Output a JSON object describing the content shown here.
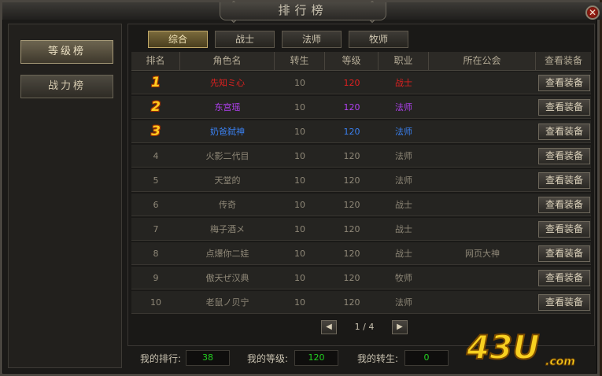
{
  "window": {
    "title": "排行榜",
    "close_icon": "close-icon"
  },
  "sidebar": {
    "items": [
      {
        "label": "等级榜",
        "active": true
      },
      {
        "label": "战力榜",
        "active": false
      }
    ]
  },
  "tabs": [
    {
      "label": "综合",
      "active": true
    },
    {
      "label": "战士",
      "active": false
    },
    {
      "label": "法师",
      "active": false
    },
    {
      "label": "牧师",
      "active": false
    }
  ],
  "table": {
    "headers": [
      "排名",
      "角色名",
      "转生",
      "等级",
      "职业",
      "所在公会",
      "查看装备"
    ],
    "rows": [
      {
        "rank": "1",
        "name": "先知ミ心",
        "rebirth": "10",
        "level": "120",
        "class": "战士",
        "guild": "",
        "button": "查看装备",
        "color": "#e02020"
      },
      {
        "rank": "2",
        "name": "东宫瑶",
        "rebirth": "10",
        "level": "120",
        "class": "法师",
        "guild": "",
        "button": "查看装备",
        "color": "#b040f0"
      },
      {
        "rank": "3",
        "name": "奶爸弑神",
        "rebirth": "10",
        "level": "120",
        "class": "法师",
        "guild": "",
        "button": "查看装备",
        "color": "#3a80f0"
      },
      {
        "rank": "4",
        "name": "火影二代目",
        "rebirth": "10",
        "level": "120",
        "class": "法师",
        "guild": "",
        "button": "查看装备",
        "color": ""
      },
      {
        "rank": "5",
        "name": "天堂的",
        "rebirth": "10",
        "level": "120",
        "class": "法师",
        "guild": "",
        "button": "查看装备",
        "color": ""
      },
      {
        "rank": "6",
        "name": "传奇",
        "rebirth": "10",
        "level": "120",
        "class": "战士",
        "guild": "",
        "button": "查看装备",
        "color": ""
      },
      {
        "rank": "7",
        "name": "梅子酒メ",
        "rebirth": "10",
        "level": "120",
        "class": "战士",
        "guild": "",
        "button": "查看装备",
        "color": ""
      },
      {
        "rank": "8",
        "name": "点爆你二娃",
        "rebirth": "10",
        "level": "120",
        "class": "战士",
        "guild": "网页大神",
        "button": "查看装备",
        "color": ""
      },
      {
        "rank": "9",
        "name": "傲天ぜ汉典",
        "rebirth": "10",
        "level": "120",
        "class": "牧师",
        "guild": "",
        "button": "查看装备",
        "color": ""
      },
      {
        "rank": "10",
        "name": "老鼠ノ贝宁",
        "rebirth": "10",
        "level": "120",
        "class": "法师",
        "guild": "",
        "button": "查看装备",
        "color": ""
      }
    ]
  },
  "pager": {
    "text": "1 / 4",
    "prev_icon": "arrow-left-icon",
    "next_icon": "arrow-right-icon"
  },
  "footer": {
    "my_rank_label": "我的排行:",
    "my_rank": "38",
    "my_level_label": "我的等级:",
    "my_level": "120",
    "my_rebirth_label": "我的转生:",
    "my_rebirth": "0"
  },
  "logo": {
    "text": "43U",
    "suffix": ".com"
  }
}
